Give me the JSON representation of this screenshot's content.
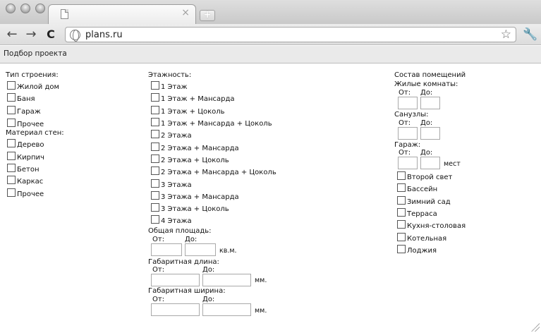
{
  "browser": {
    "url": "plans.ru",
    "tab_close": "×",
    "new_tab": "+",
    "back": "←",
    "forward": "→",
    "reload": "C",
    "star": "☆",
    "wrench": "🔧",
    "bookmark": "Подбор проекта"
  },
  "building": {
    "title": "Тип строения:",
    "items": [
      "Жилой дом",
      "Баня",
      "Гараж",
      "Прочее"
    ]
  },
  "material": {
    "title": "Материал стен:",
    "items": [
      "Дерево",
      "Кирпич",
      "Бетон",
      "Каркас",
      "Прочее"
    ]
  },
  "floors": {
    "title": "Этажность:",
    "items": [
      "1 Этаж",
      "1 Этаж + Мансарда",
      "1 Этаж + Цоколь",
      "1 Этаж + Мансарда + Цоколь",
      "2 Этажа",
      "2 Этажа + Мансарда",
      "2 Этажа + Цоколь",
      "2 Этажа + Мансарда + Цоколь",
      "3 Этажа",
      "3 Этажа + Мансарда",
      "3 Этажа + Цоколь",
      "4 Этажа"
    ]
  },
  "area": {
    "title": "Общая площадь:",
    "from": "От:",
    "to": "До:",
    "unit": "кв.м."
  },
  "length": {
    "title": "Габаритная длина:",
    "from": "От:",
    "to": "До:",
    "unit": "мм."
  },
  "width": {
    "title": "Габаритная ширина:",
    "from": "От:",
    "to": "До:",
    "unit": "мм."
  },
  "rooms": {
    "title": "Состав помещений",
    "living": {
      "title": "Жилые комнаты:",
      "from": "От:",
      "to": "До:"
    },
    "bath": {
      "title": "Санузлы:",
      "from": "От:",
      "to": "До:"
    },
    "garage": {
      "title": "Гараж:",
      "from": "От:",
      "to": "До:",
      "unit": "мест"
    },
    "extras": [
      "Второй свет",
      "Бассейн",
      "Зимний сад",
      "Терраса",
      "Кухня-столовая",
      "Котельная",
      "Лоджия"
    ]
  }
}
